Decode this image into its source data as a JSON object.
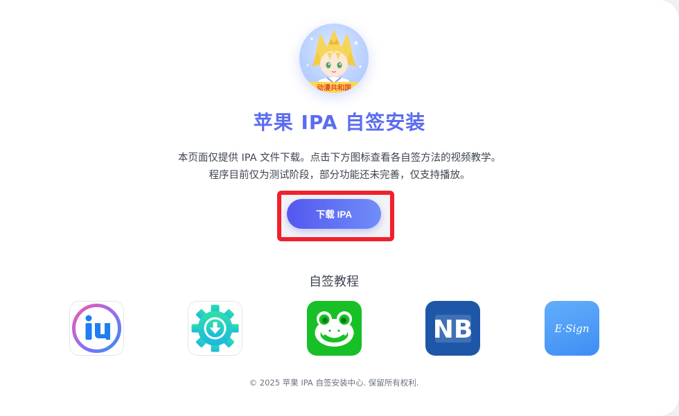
{
  "page": {
    "title": "苹果 IPA 自签安装",
    "description_line1": "本页面仅提供 IPA 文件下载。点击下方图标查看各自签方法的视频教学。",
    "description_line2": "程序目前仅为测试阶段，部分功能还未完善，仅支持播放。",
    "avatar_caption": "动漫共和国"
  },
  "download": {
    "button_label": "下载 IPA"
  },
  "tutorials": {
    "section_title": "自签教程",
    "apps": [
      {
        "icon": "i4-icon"
      },
      {
        "icon": "download-gear-icon"
      },
      {
        "icon": "frog-icon"
      },
      {
        "icon": "nb-icon",
        "text": "NB"
      },
      {
        "icon": "esign-icon",
        "text": "E·Sign"
      }
    ]
  },
  "footer": {
    "copyright": "© 2025 苹果 IPA 自签安装中心. 保留所有权利."
  },
  "colors": {
    "accent": "#5b6cf0",
    "highlight": "#f0202c",
    "frog_green": "#17c026",
    "nb_blue": "#1f57a8",
    "esign_blue": "#4a96f6"
  }
}
